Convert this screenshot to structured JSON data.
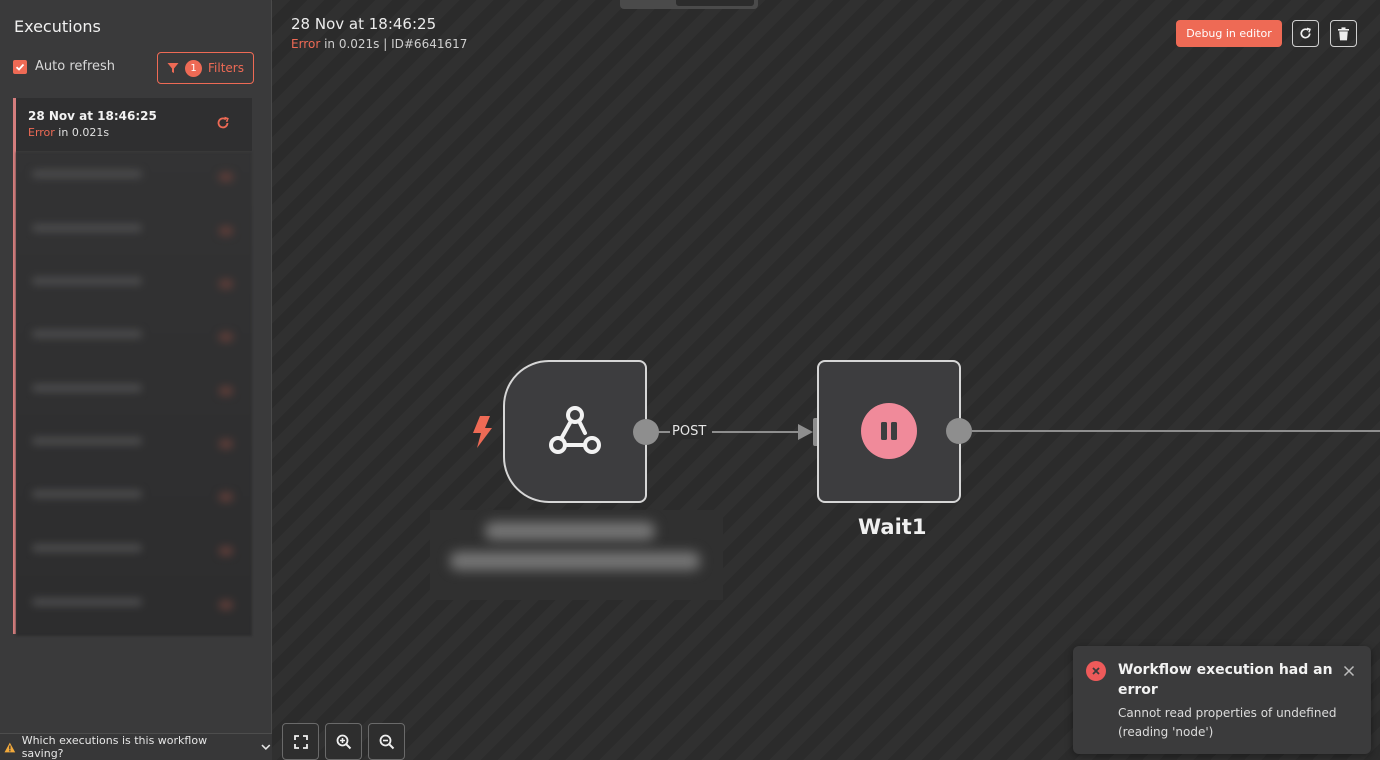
{
  "sidebar": {
    "title": "Executions",
    "auto_refresh_label": "Auto refresh",
    "filters": {
      "count": "1",
      "label": "Filters"
    },
    "executions": [
      {
        "date": "28 Nov at 18:46:25",
        "status": "Error",
        "duration_text": " in 0.021s"
      }
    ],
    "footer_text": "Which executions is this workflow saving?"
  },
  "canvas": {
    "title": "28 Nov at 18:46:25",
    "status": "Error",
    "subtitle_rest": " in 0.021s | ID#6641617",
    "debug_button": "Debug in editor",
    "connection_label": "POST",
    "wait_node_name": "Wait1"
  },
  "toast": {
    "title": "Workflow execution had an error",
    "message": "Cannot read properties of undefined (reading 'node')"
  },
  "colors": {
    "accent": "#ee6a55",
    "error": "#ee5a5a",
    "wait_icon": "#f08a9a"
  }
}
